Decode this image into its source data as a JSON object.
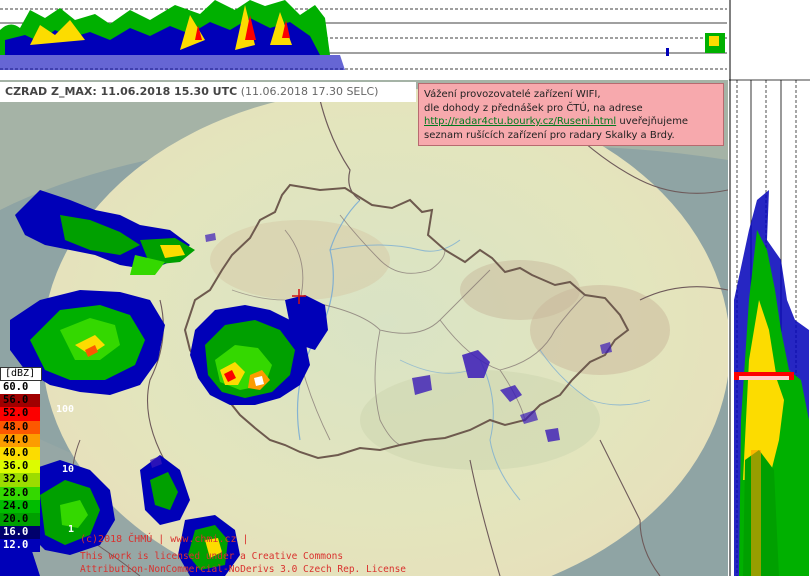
{
  "header": {
    "title": "CZRAD Z_MAX: 11.06.2018 15.30 UTC",
    "local_time": "(11.06.2018 17.30 SELC)"
  },
  "notice": {
    "line1": "Vážení provozovatelé zařízení WIFI,",
    "line2": "dle dohody z přednášek pro ČTÚ, na adrese",
    "link": "http://radar4ctu.bourky.cz/Ruseni.html",
    "after_link": " uveřejňujeme",
    "line4": "seznam rušících zařízení pro radary Skalky a Brdy.",
    "bg_color": "#f7a9ad"
  },
  "legend": {
    "unit": "[dBZ]",
    "levels": [
      {
        "label": "60.0",
        "color": "#ffffff",
        "text": "#000000"
      },
      {
        "label": "56.0",
        "color": "#a00000",
        "text": "#000000"
      },
      {
        "label": "52.0",
        "color": "#fc0000",
        "text": "#000000"
      },
      {
        "label": "48.0",
        "color": "#fc5800",
        "text": "#000000"
      },
      {
        "label": "44.0",
        "color": "#fc9c00",
        "text": "#000000"
      },
      {
        "label": "40.0",
        "color": "#fcdc00",
        "text": "#000000"
      },
      {
        "label": "36.0",
        "color": "#dcfc00",
        "text": "#000000"
      },
      {
        "label": "32.0",
        "color": "#9cdc00",
        "text": "#000000"
      },
      {
        "label": "28.0",
        "color": "#34d800",
        "text": "#000000"
      },
      {
        "label": "24.0",
        "color": "#00bc00",
        "text": "#000000"
      },
      {
        "label": "20.0",
        "color": "#00a000",
        "text": "#000000"
      },
      {
        "label": "16.0",
        "color": "#00006c",
        "text": "#ffffff"
      },
      {
        "label": "12.0",
        "color": "#0000b8",
        "text": "#ffffff"
      }
    ]
  },
  "range_labels": [
    "100",
    "10",
    "1"
  ],
  "copyright": {
    "line1": "(c)2018 ČHMÚ | www.chmi.cz |",
    "line2": "This work is licensed under a Creative Commons",
    "line3": "Attribution-NonCommercial-NoDerivs 3.0 Czech Rep. License"
  }
}
